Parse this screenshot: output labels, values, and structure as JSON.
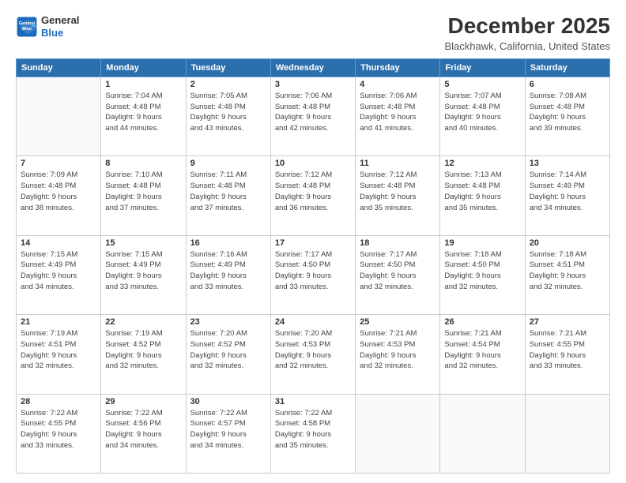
{
  "logo": {
    "line1": "General",
    "line2": "Blue"
  },
  "title": "December 2025",
  "subtitle": "Blackhawk, California, United States",
  "days_of_week": [
    "Sunday",
    "Monday",
    "Tuesday",
    "Wednesday",
    "Thursday",
    "Friday",
    "Saturday"
  ],
  "weeks": [
    [
      {
        "num": "",
        "info": ""
      },
      {
        "num": "1",
        "info": "Sunrise: 7:04 AM\nSunset: 4:48 PM\nDaylight: 9 hours\nand 44 minutes."
      },
      {
        "num": "2",
        "info": "Sunrise: 7:05 AM\nSunset: 4:48 PM\nDaylight: 9 hours\nand 43 minutes."
      },
      {
        "num": "3",
        "info": "Sunrise: 7:06 AM\nSunset: 4:48 PM\nDaylight: 9 hours\nand 42 minutes."
      },
      {
        "num": "4",
        "info": "Sunrise: 7:06 AM\nSunset: 4:48 PM\nDaylight: 9 hours\nand 41 minutes."
      },
      {
        "num": "5",
        "info": "Sunrise: 7:07 AM\nSunset: 4:48 PM\nDaylight: 9 hours\nand 40 minutes."
      },
      {
        "num": "6",
        "info": "Sunrise: 7:08 AM\nSunset: 4:48 PM\nDaylight: 9 hours\nand 39 minutes."
      }
    ],
    [
      {
        "num": "7",
        "info": "Sunrise: 7:09 AM\nSunset: 4:48 PM\nDaylight: 9 hours\nand 38 minutes."
      },
      {
        "num": "8",
        "info": "Sunrise: 7:10 AM\nSunset: 4:48 PM\nDaylight: 9 hours\nand 37 minutes."
      },
      {
        "num": "9",
        "info": "Sunrise: 7:11 AM\nSunset: 4:48 PM\nDaylight: 9 hours\nand 37 minutes."
      },
      {
        "num": "10",
        "info": "Sunrise: 7:12 AM\nSunset: 4:48 PM\nDaylight: 9 hours\nand 36 minutes."
      },
      {
        "num": "11",
        "info": "Sunrise: 7:12 AM\nSunset: 4:48 PM\nDaylight: 9 hours\nand 35 minutes."
      },
      {
        "num": "12",
        "info": "Sunrise: 7:13 AM\nSunset: 4:48 PM\nDaylight: 9 hours\nand 35 minutes."
      },
      {
        "num": "13",
        "info": "Sunrise: 7:14 AM\nSunset: 4:49 PM\nDaylight: 9 hours\nand 34 minutes."
      }
    ],
    [
      {
        "num": "14",
        "info": "Sunrise: 7:15 AM\nSunset: 4:49 PM\nDaylight: 9 hours\nand 34 minutes."
      },
      {
        "num": "15",
        "info": "Sunrise: 7:15 AM\nSunset: 4:49 PM\nDaylight: 9 hours\nand 33 minutes."
      },
      {
        "num": "16",
        "info": "Sunrise: 7:16 AM\nSunset: 4:49 PM\nDaylight: 9 hours\nand 33 minutes."
      },
      {
        "num": "17",
        "info": "Sunrise: 7:17 AM\nSunset: 4:50 PM\nDaylight: 9 hours\nand 33 minutes."
      },
      {
        "num": "18",
        "info": "Sunrise: 7:17 AM\nSunset: 4:50 PM\nDaylight: 9 hours\nand 32 minutes."
      },
      {
        "num": "19",
        "info": "Sunrise: 7:18 AM\nSunset: 4:50 PM\nDaylight: 9 hours\nand 32 minutes."
      },
      {
        "num": "20",
        "info": "Sunrise: 7:18 AM\nSunset: 4:51 PM\nDaylight: 9 hours\nand 32 minutes."
      }
    ],
    [
      {
        "num": "21",
        "info": "Sunrise: 7:19 AM\nSunset: 4:51 PM\nDaylight: 9 hours\nand 32 minutes."
      },
      {
        "num": "22",
        "info": "Sunrise: 7:19 AM\nSunset: 4:52 PM\nDaylight: 9 hours\nand 32 minutes."
      },
      {
        "num": "23",
        "info": "Sunrise: 7:20 AM\nSunset: 4:52 PM\nDaylight: 9 hours\nand 32 minutes."
      },
      {
        "num": "24",
        "info": "Sunrise: 7:20 AM\nSunset: 4:53 PM\nDaylight: 9 hours\nand 32 minutes."
      },
      {
        "num": "25",
        "info": "Sunrise: 7:21 AM\nSunset: 4:53 PM\nDaylight: 9 hours\nand 32 minutes."
      },
      {
        "num": "26",
        "info": "Sunrise: 7:21 AM\nSunset: 4:54 PM\nDaylight: 9 hours\nand 32 minutes."
      },
      {
        "num": "27",
        "info": "Sunrise: 7:21 AM\nSunset: 4:55 PM\nDaylight: 9 hours\nand 33 minutes."
      }
    ],
    [
      {
        "num": "28",
        "info": "Sunrise: 7:22 AM\nSunset: 4:55 PM\nDaylight: 9 hours\nand 33 minutes."
      },
      {
        "num": "29",
        "info": "Sunrise: 7:22 AM\nSunset: 4:56 PM\nDaylight: 9 hours\nand 34 minutes."
      },
      {
        "num": "30",
        "info": "Sunrise: 7:22 AM\nSunset: 4:57 PM\nDaylight: 9 hours\nand 34 minutes."
      },
      {
        "num": "31",
        "info": "Sunrise: 7:22 AM\nSunset: 4:58 PM\nDaylight: 9 hours\nand 35 minutes."
      },
      {
        "num": "",
        "info": ""
      },
      {
        "num": "",
        "info": ""
      },
      {
        "num": "",
        "info": ""
      }
    ]
  ]
}
